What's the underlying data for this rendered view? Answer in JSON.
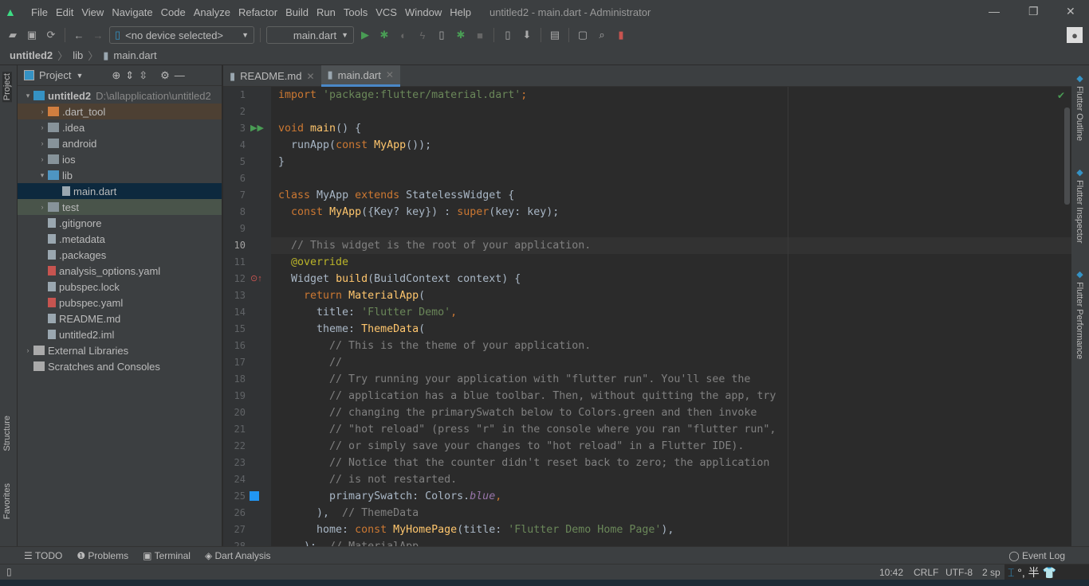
{
  "menu": {
    "items": [
      "File",
      "Edit",
      "View",
      "Navigate",
      "Code",
      "Analyze",
      "Refactor",
      "Build",
      "Run",
      "Tools",
      "VCS",
      "Window",
      "Help"
    ],
    "title": "untitled2 - main.dart - Administrator"
  },
  "toolbar": {
    "device": "<no device selected>",
    "config": "main.dart"
  },
  "breadcrumb": [
    "untitled2",
    "lib",
    "main.dart"
  ],
  "left_tabs": {
    "project": "Project",
    "structure": "Structure",
    "favorites": "Favorites"
  },
  "project": {
    "header": "Project",
    "tree": [
      {
        "label": "untitled2",
        "path": "D:\\allapplication\\untitled2",
        "depth": 0,
        "arrow": "▾",
        "type": "module",
        "bold": true
      },
      {
        "label": ".dart_tool",
        "depth": 1,
        "arrow": "›",
        "type": "folder-orange",
        "bg": "#4d4033"
      },
      {
        "label": ".idea",
        "depth": 1,
        "arrow": "›",
        "type": "folder"
      },
      {
        "label": "android",
        "depth": 1,
        "arrow": "›",
        "type": "folder"
      },
      {
        "label": "ios",
        "depth": 1,
        "arrow": "›",
        "type": "folder"
      },
      {
        "label": "lib",
        "depth": 1,
        "arrow": "▾",
        "type": "folder-blue"
      },
      {
        "label": "main.dart",
        "depth": 2,
        "arrow": "",
        "type": "dart",
        "bg": "#0d293e"
      },
      {
        "label": "test",
        "depth": 1,
        "arrow": "›",
        "type": "folder-green",
        "bg": "#49544a"
      },
      {
        "label": ".gitignore",
        "depth": 1,
        "arrow": "",
        "type": "file"
      },
      {
        "label": ".metadata",
        "depth": 1,
        "arrow": "",
        "type": "file"
      },
      {
        "label": ".packages",
        "depth": 1,
        "arrow": "",
        "type": "file"
      },
      {
        "label": "analysis_options.yaml",
        "depth": 1,
        "arrow": "",
        "type": "yaml"
      },
      {
        "label": "pubspec.lock",
        "depth": 1,
        "arrow": "",
        "type": "file"
      },
      {
        "label": "pubspec.yaml",
        "depth": 1,
        "arrow": "",
        "type": "yaml"
      },
      {
        "label": "README.md",
        "depth": 1,
        "arrow": "",
        "type": "file"
      },
      {
        "label": "untitled2.iml",
        "depth": 1,
        "arrow": "",
        "type": "file"
      },
      {
        "label": "External Libraries",
        "depth": 0,
        "arrow": "›",
        "type": "lib"
      },
      {
        "label": "Scratches and Consoles",
        "depth": 0,
        "arrow": "",
        "type": "scratch"
      }
    ]
  },
  "tabs": [
    {
      "label": "README.md",
      "active": false
    },
    {
      "label": "main.dart",
      "active": true
    }
  ],
  "code": [
    [
      [
        "import ",
        "kw"
      ],
      [
        "'package:flutter/material.dart'",
        "str"
      ],
      [
        ";",
        "kw"
      ]
    ],
    [],
    [
      [
        "void ",
        "kw"
      ],
      [
        "main",
        "cls"
      ],
      [
        "() {",
        "id"
      ]
    ],
    [
      [
        "  runApp(",
        "id"
      ],
      [
        "const ",
        "kw"
      ],
      [
        "MyApp",
        "cls"
      ],
      [
        "());",
        "id"
      ]
    ],
    [
      [
        "}",
        "id"
      ]
    ],
    [],
    [
      [
        "class ",
        "kw"
      ],
      [
        "MyApp ",
        "id"
      ],
      [
        "extends ",
        "kw"
      ],
      [
        "StatelessWidget {",
        "id"
      ]
    ],
    [
      [
        "  "
      ],
      [
        "const ",
        "kw"
      ],
      [
        "MyApp",
        "cls"
      ],
      [
        "({Key? key}) : ",
        "id"
      ],
      [
        "super",
        "kw"
      ],
      [
        "(key: key);",
        "id"
      ]
    ],
    [],
    [
      [
        "  // This widget is the root of your application.",
        "cm"
      ]
    ],
    [
      [
        "  "
      ],
      [
        "@override",
        "ann"
      ]
    ],
    [
      [
        "  Widget ",
        "id"
      ],
      [
        "build",
        "cls"
      ],
      [
        "(BuildContext context) {",
        "id"
      ]
    ],
    [
      [
        "    "
      ],
      [
        "return ",
        "kw"
      ],
      [
        "MaterialApp",
        "cls"
      ],
      [
        "(",
        "id"
      ]
    ],
    [
      [
        "      title: ",
        "id"
      ],
      [
        "'Flutter Demo'",
        "str"
      ],
      [
        ",",
        "kw"
      ]
    ],
    [
      [
        "      theme: ",
        "id"
      ],
      [
        "ThemeData",
        "cls"
      ],
      [
        "(",
        "id"
      ]
    ],
    [
      [
        "        // This is the theme of your application.",
        "cm"
      ]
    ],
    [
      [
        "        //",
        "cm"
      ]
    ],
    [
      [
        "        // Try running your application with \"flutter run\". You'll see the",
        "cm"
      ]
    ],
    [
      [
        "        // application has a blue toolbar. Then, without quitting the app, try",
        "cm"
      ]
    ],
    [
      [
        "        // changing the primarySwatch below to Colors.green and then invoke",
        "cm"
      ]
    ],
    [
      [
        "        // \"hot reload\" (press \"r\" in the console where you ran \"flutter run\",",
        "cm"
      ]
    ],
    [
      [
        "        // or simply save your changes to \"hot reload\" in a Flutter IDE).",
        "cm"
      ]
    ],
    [
      [
        "        // Notice that the counter didn't reset back to zero; the application",
        "cm"
      ]
    ],
    [
      [
        "        // is not restarted.",
        "cm"
      ]
    ],
    [
      [
        "        primarySwatch: Colors.",
        "id"
      ],
      [
        "blue",
        "it"
      ],
      [
        ",",
        "kw"
      ]
    ],
    [
      [
        "      ),",
        "id"
      ],
      [
        "  // ThemeData",
        "cm"
      ]
    ],
    [
      [
        "      home: ",
        "id"
      ],
      [
        "const ",
        "kw"
      ],
      [
        "MyHomePage",
        "cls"
      ],
      [
        "(title: ",
        "id"
      ],
      [
        "'Flutter Demo Home Page'",
        "str"
      ],
      [
        "),",
        "id"
      ]
    ],
    [
      [
        "    );",
        "id"
      ],
      [
        "  // MaterialApp",
        "cm"
      ]
    ]
  ],
  "right_tabs": [
    "Flutter Outline",
    "Flutter Inspector",
    "Flutter Performance"
  ],
  "bottom_tools": [
    "TODO",
    "Problems",
    "Terminal",
    "Dart Analysis"
  ],
  "event_log": "Event Log",
  "status": {
    "position": "10:42",
    "line_sep": "CRLF",
    "encoding": "UTF-8",
    "indent": "2 sp"
  },
  "colors": {
    "accent": "#4a88c7",
    "selection": "#0d293e"
  }
}
